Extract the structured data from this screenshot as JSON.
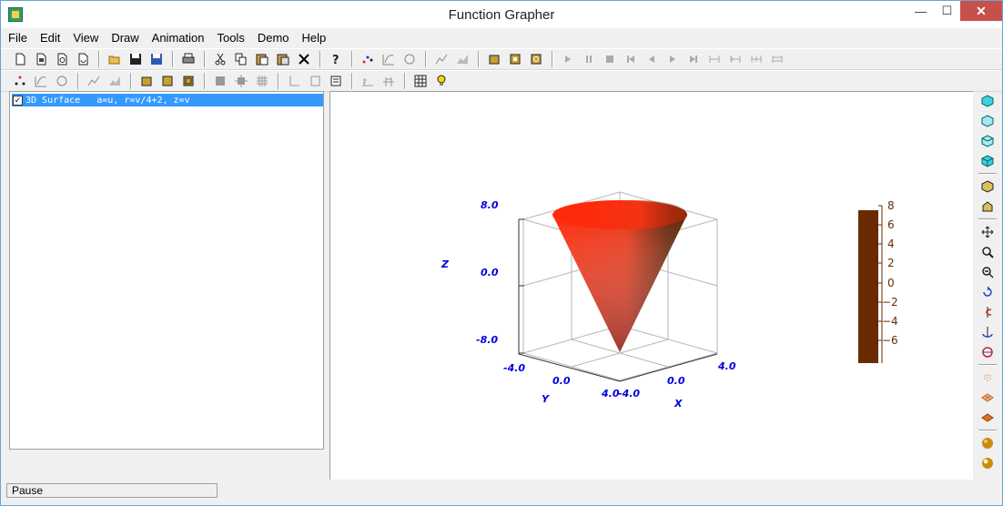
{
  "window": {
    "title": "Function Grapher",
    "controls": {
      "minimize": "—",
      "maximize": "☐",
      "close": "✕"
    }
  },
  "menu": [
    "File",
    "Edit",
    "View",
    "Draw",
    "Animation",
    "Tools",
    "Demo",
    "Help"
  ],
  "toolbar1": {
    "icons": [
      "new-icon",
      "new-2d-icon",
      "new-3d-icon",
      "new-param-icon",
      "open-folder-icon",
      "save-icon",
      "save-as-icon",
      "print-icon",
      "cut-icon",
      "copy-icon",
      "paste-icon",
      "paste-special-icon",
      "delete-icon",
      "help-icon",
      "points-icon",
      "curve-icon",
      "refresh-icon",
      "graph-a-icon",
      "graph-b-icon",
      "cube-gold-icon",
      "cube-page-icon",
      "cube-refresh-icon",
      "play-icon",
      "pause-icon",
      "stop-icon",
      "first-icon",
      "prev-icon",
      "next-icon",
      "last-icon",
      "range-a-icon",
      "range-b-icon",
      "range-c-icon",
      "range-d-icon"
    ]
  },
  "toolbar2": {
    "icons": [
      "scatter-icon",
      "curve-outline-icon",
      "polar-icon",
      "graph-line-icon",
      "graph-area-icon",
      "cube-solid-icon",
      "cube-face-icon",
      "cube-wire-icon",
      "square-icon",
      "gear-grid-icon",
      "grid-icon",
      "axis-a-icon",
      "axis-b-icon",
      "axis-c-icon",
      "axis-d-icon",
      "tick-a-icon",
      "tick-b-icon",
      "table-icon",
      "lightbulb-icon"
    ]
  },
  "tree": {
    "checked": true,
    "items": [
      {
        "label": "3D Surface   a=u, r=v/4+2, z=v"
      }
    ]
  },
  "status": {
    "text": "Pause"
  },
  "graph": {
    "z_axis": {
      "label": "Z",
      "ticks": [
        "8.0",
        "0.0",
        "-8.0"
      ]
    },
    "y_axis": {
      "label": "Y",
      "ticks": [
        "-4.0",
        "0.0",
        "4.0"
      ]
    },
    "x_axis": {
      "label": "X",
      "ticks": [
        "-4.0",
        "0.0",
        "4.0"
      ]
    },
    "colorbar": {
      "ticks": [
        "8",
        "6",
        "4",
        "2",
        "0",
        "−2",
        "−4",
        "−6"
      ],
      "color": "#6a2a00"
    },
    "axis_color": "#0000dd",
    "surface_color_top": "#ff2a0c",
    "surface_color_bottom": "#5a2a2a"
  },
  "rightbar": {
    "icons": [
      "view-cube-front-icon",
      "view-cube-side-icon",
      "view-cube-top-icon",
      "view-cube-iso-icon",
      "cube-gold-icon",
      "home-view-icon",
      "move-icon",
      "zoom-in-icon",
      "zoom-out-icon",
      "rotate-x-icon",
      "rotate-y-icon",
      "rotate-z-icon",
      "rotate-free-icon",
      "surface-dots-icon",
      "surface-grid-icon",
      "surface-solid-icon",
      "sphere-shade-icon",
      "sphere-light-icon"
    ]
  }
}
